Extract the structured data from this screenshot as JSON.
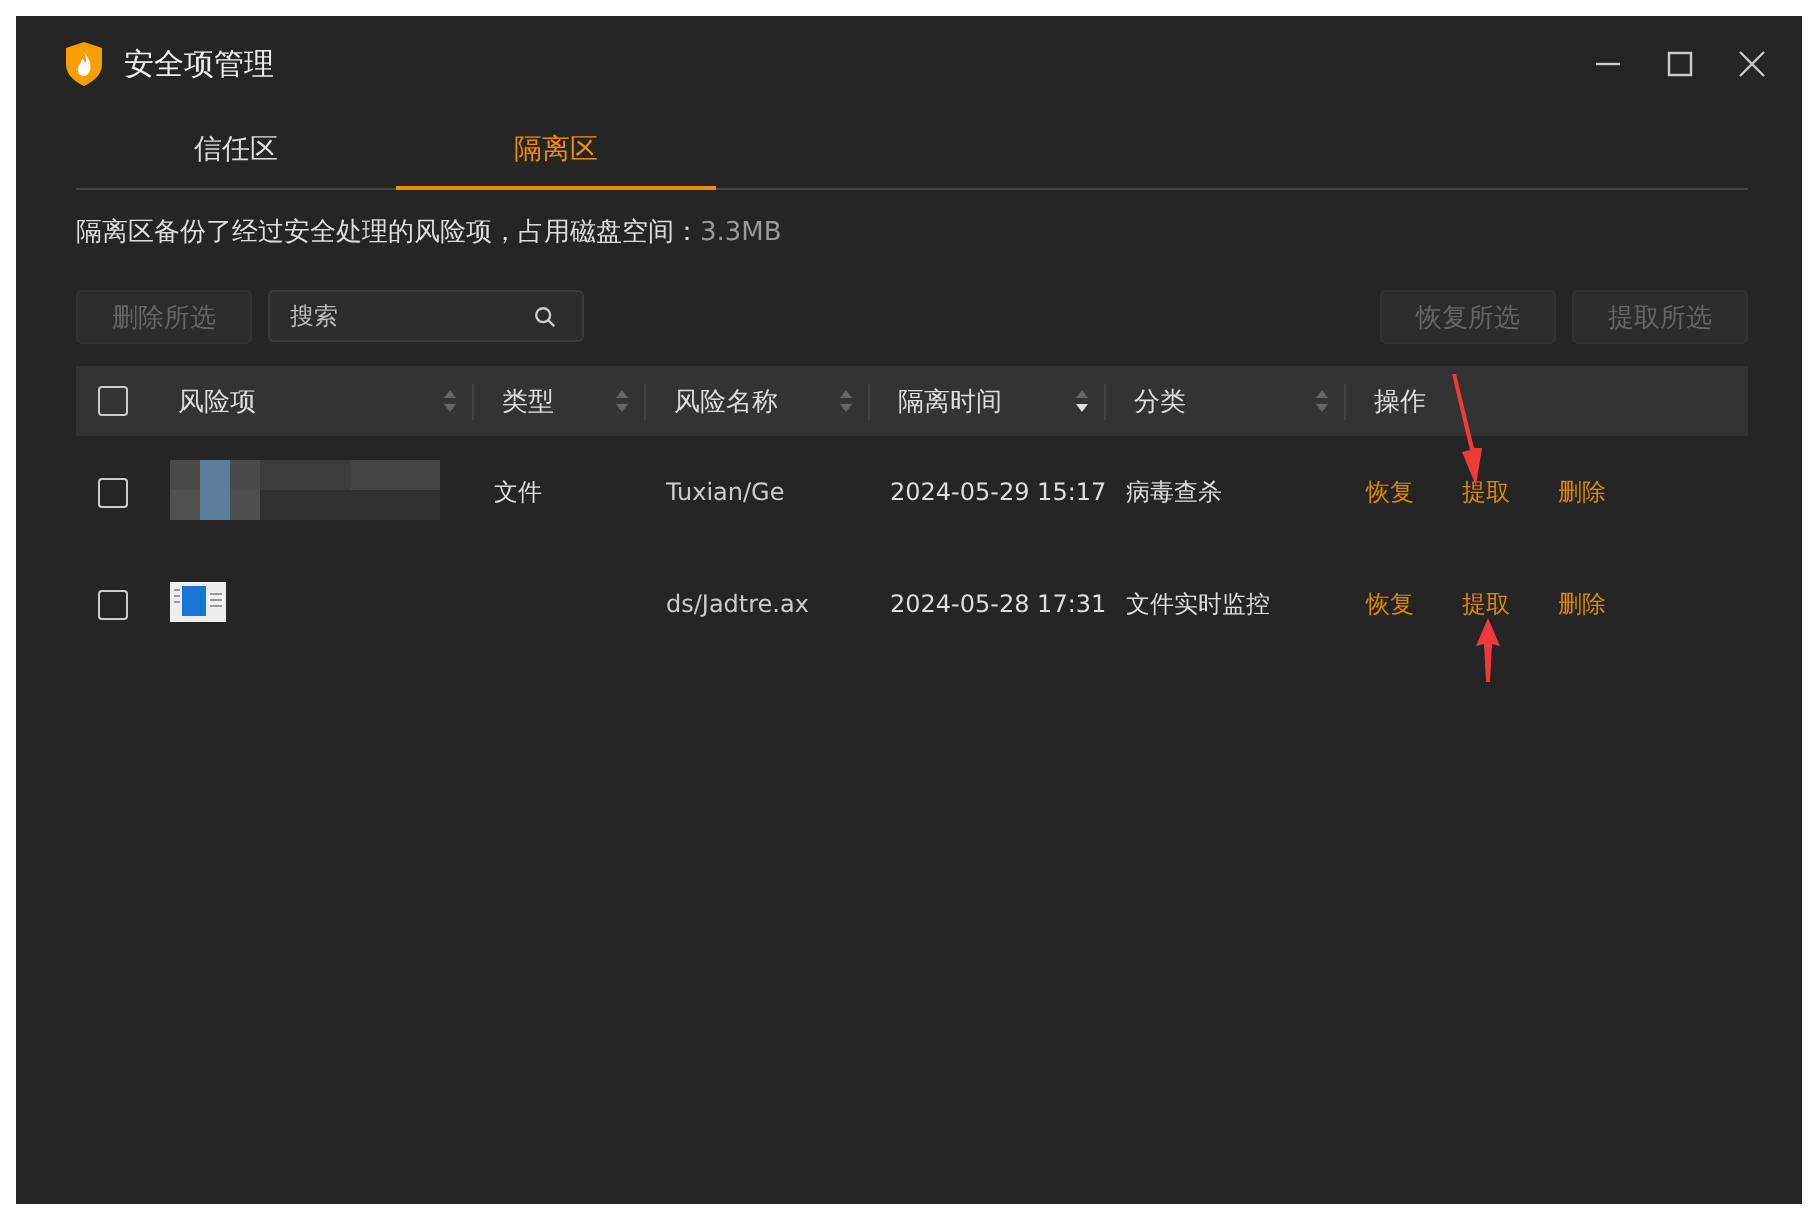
{
  "window": {
    "title": "安全项管理"
  },
  "tabs": [
    {
      "label": "信任区",
      "selected": false
    },
    {
      "label": "隔离区",
      "selected": true
    }
  ],
  "description": {
    "text": "隔离区备份了经过安全处理的风险项，占用磁盘空间：",
    "value": "3.3MB"
  },
  "toolbar": {
    "left_buttons": [
      {
        "label": "删除所选",
        "disabled": true
      }
    ],
    "search": {
      "placeholder": "搜索"
    },
    "right_buttons": [
      {
        "label": "恢复所选",
        "disabled": true
      },
      {
        "label": "提取所选",
        "disabled": true
      }
    ]
  },
  "table": {
    "select_all": {
      "checked": false
    },
    "columns": [
      {
        "label": "风险项",
        "sorted": false
      },
      {
        "label": "类型",
        "sorted": false
      },
      {
        "label": "风险名称",
        "sorted": false
      },
      {
        "label": "隔离时间",
        "sorted": true
      },
      {
        "label": "分类",
        "sorted": false
      },
      {
        "label": "操作"
      }
    ],
    "rows": [
      {
        "checked": false,
        "kind": "redacted",
        "type": "文件",
        "risk_name": "Tuxian/Ge",
        "time": "2024-05-29 15:17",
        "category": "病毒查杀",
        "actions": [
          "恢复",
          "提取",
          "删除"
        ]
      },
      {
        "checked": false,
        "kind": "document",
        "risk_name": "ds/Jadtre.ax",
        "time": "2024-05-28 17:31",
        "category": "文件实时监控",
        "actions": [
          "恢复",
          "提取",
          "删除"
        ]
      }
    ]
  }
}
